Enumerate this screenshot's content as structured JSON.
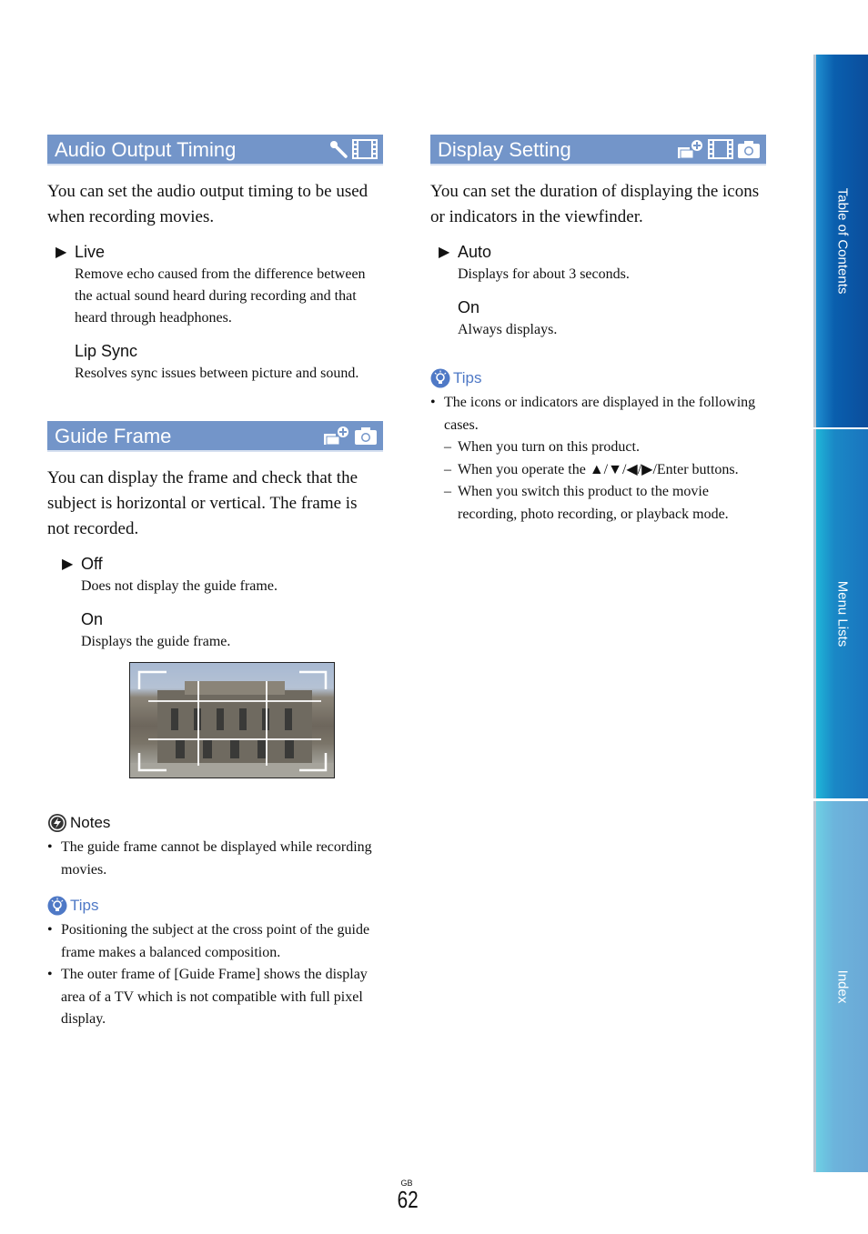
{
  "sections": {
    "audio_output_timing": {
      "title": "Audio Output Timing",
      "mode_icons": [
        "microphone-icon",
        "movie-film-icon"
      ],
      "intro": "You can set the audio output timing to be used when recording movies.",
      "options": [
        {
          "label": "Live",
          "default": true,
          "desc": "Remove echo caused from the difference between the actual sound heard during recording and that heard through headphones."
        },
        {
          "label": "Lip Sync",
          "default": false,
          "desc": "Resolves sync issues between picture and sound."
        }
      ]
    },
    "guide_frame": {
      "title": "Guide Frame",
      "mode_icons": [
        "playback-plus-icon",
        "camera-icon"
      ],
      "intro": "You can display the frame and check that the subject is horizontal or vertical. The frame is not recorded.",
      "options": [
        {
          "label": "Off",
          "default": true,
          "desc": "Does not display the guide frame."
        },
        {
          "label": "On",
          "default": false,
          "desc": "Displays the guide frame."
        }
      ],
      "image": "guide-frame-example-photo",
      "notes": {
        "heading": "Notes",
        "items": [
          "The guide frame cannot be displayed while recording movies."
        ]
      },
      "tips": {
        "heading": "Tips",
        "items": [
          "Positioning the subject at the cross point of the guide frame makes a balanced composition.",
          "The outer frame of [Guide Frame] shows the display area of a TV which is not compatible with full pixel display."
        ]
      }
    },
    "display_setting": {
      "title": "Display Setting",
      "mode_icons": [
        "playback-plus-icon",
        "movie-film-icon",
        "camera-icon"
      ],
      "intro": "You can set the duration of displaying the icons or indicators in the viewfinder.",
      "options": [
        {
          "label": "Auto",
          "default": true,
          "desc": "Displays for about 3 seconds."
        },
        {
          "label": "On",
          "default": false,
          "desc": "Always displays."
        }
      ],
      "tips": {
        "heading": "Tips",
        "items": [
          "The icons or indicators are displayed in the following cases."
        ],
        "sub_items": [
          "When you turn on this product.",
          "When you operate the ▲/▼/◀/▶/Enter buttons.",
          "When you switch this product to the movie recording, photo recording, or playback mode."
        ]
      }
    }
  },
  "sidebar": {
    "tabs": [
      {
        "label": "Table of Contents",
        "color": "#0b4d9c"
      },
      {
        "label": "Menu Lists",
        "color": "#1a74be"
      },
      {
        "label": "Index",
        "color": "#6ba8d6"
      }
    ]
  },
  "footer": {
    "region": "GB",
    "page_number": "62"
  },
  "colors": {
    "section_header": "#7395c9",
    "tips_accent": "#4f79c6"
  }
}
